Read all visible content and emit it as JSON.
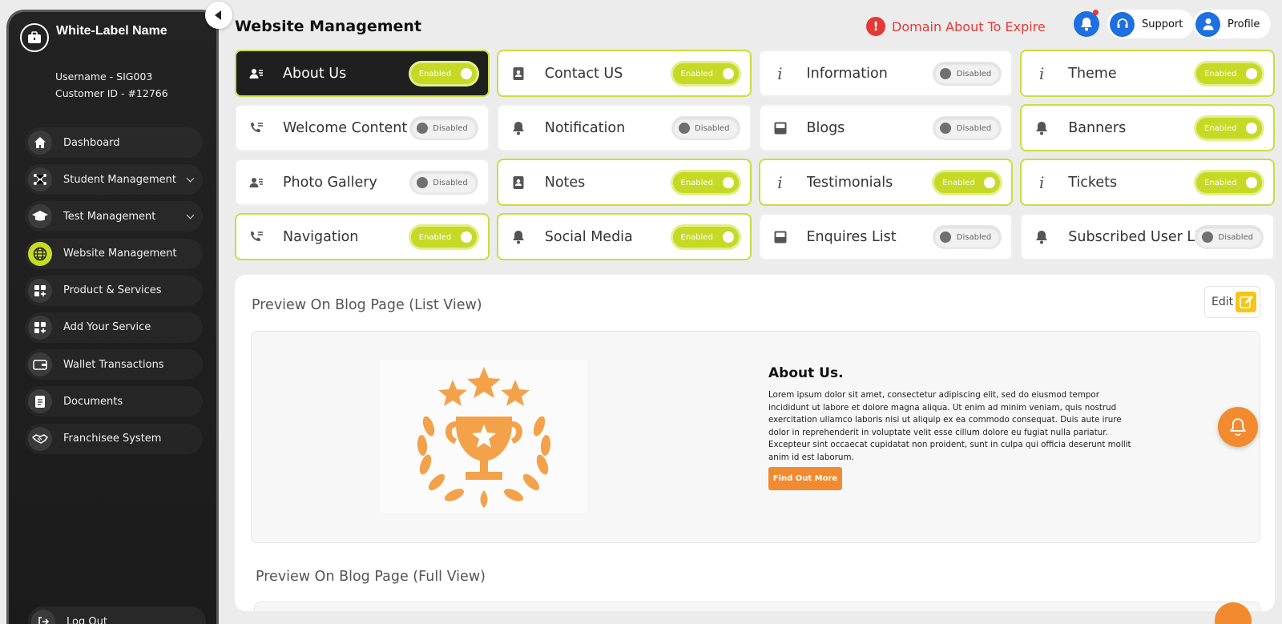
{
  "brand": {
    "name": "White-Label Name"
  },
  "user": {
    "username": "Username - SIG003",
    "customer_id": "Customer ID - #12766"
  },
  "menu": [
    {
      "label": "Dashboard",
      "icon": "home-icon",
      "active": false,
      "expandable": false
    },
    {
      "label": "Student Management",
      "icon": "users-network-icon",
      "active": false,
      "expandable": true
    },
    {
      "label": "Test Management",
      "icon": "graduation-cap-icon",
      "active": false,
      "expandable": true
    },
    {
      "label": "Website Management",
      "icon": "globe-icon",
      "active": true,
      "expandable": false
    },
    {
      "label": "Product & Services",
      "icon": "grid-plus-icon",
      "active": false,
      "expandable": false
    },
    {
      "label": "Add Your Service",
      "icon": "grid-plus-icon",
      "active": false,
      "expandable": false
    },
    {
      "label": "Wallet Transactions",
      "icon": "wallet-icon",
      "active": false,
      "expandable": false
    },
    {
      "label": "Documents",
      "icon": "document-icon",
      "active": false,
      "expandable": false
    },
    {
      "label": "Franchisee System",
      "icon": "handshake-icon",
      "active": false,
      "expandable": false
    }
  ],
  "logout_label": "Log Out",
  "header": {
    "title": "Website Management",
    "domain_alert": "Domain About To Expire",
    "support_label": "Support",
    "profile_label": "Profile"
  },
  "modules": [
    {
      "label": "About Us",
      "icon": "contact-card-icon",
      "status": "Enabled",
      "selected": true
    },
    {
      "label": "Contact US",
      "icon": "address-book-icon",
      "status": "Enabled",
      "selected": false
    },
    {
      "label": "Information",
      "icon": "info-icon",
      "status": "Disabled",
      "selected": false
    },
    {
      "label": "Theme",
      "icon": "info-icon",
      "status": "Enabled",
      "selected": false
    },
    {
      "label": "Welcome Content",
      "icon": "phone-icon",
      "status": "Disabled",
      "selected": false
    },
    {
      "label": "Notification",
      "icon": "bell-icon",
      "status": "Disabled",
      "selected": false
    },
    {
      "label": "Blogs",
      "icon": "tray-icon",
      "status": "Disabled",
      "selected": false
    },
    {
      "label": "Banners",
      "icon": "bell-icon",
      "status": "Enabled",
      "selected": false
    },
    {
      "label": "Photo Gallery",
      "icon": "contact-card-icon",
      "status": "Disabled",
      "selected": false
    },
    {
      "label": "Notes",
      "icon": "address-book-icon",
      "status": "Enabled",
      "selected": false
    },
    {
      "label": "Testimonials",
      "icon": "info-icon",
      "status": "Enabled",
      "selected": false
    },
    {
      "label": "Tickets",
      "icon": "info-icon",
      "status": "Enabled",
      "selected": false
    },
    {
      "label": "Navigation",
      "icon": "phone-icon",
      "status": "Enabled",
      "selected": false
    },
    {
      "label": "Social Media",
      "icon": "bell-icon",
      "status": "Enabled",
      "selected": false
    },
    {
      "label": "Enquires List",
      "icon": "tray-icon",
      "status": "Disabled",
      "selected": false
    },
    {
      "label": "Subscribed User Lis",
      "icon": "bell-icon",
      "status": "Disabled",
      "selected": false
    }
  ],
  "preview": {
    "title": "Preview On Blog Page (List View)",
    "edit_label": "Edit",
    "about_title": "About Us.",
    "about_text": "Lorem ipsum dolor sit amet, consectetur adipiscing elit, sed do eiusmod tempor incididunt ut labore et dolore magna aliqua. Ut enim ad minim veniam, quis nostrud exercitation ullamco laboris nisi ut aliquip ex ea commodo consequat. Duis aute irure dolor in reprehenderit in voluptate velit esse cillum dolore eu fugiat nulla pariatur. Excepteur sint occaecat cupidatat non proident, sunt in culpa qui officia deserunt mollit anim id est laborum.",
    "cta_label": "Find Out More",
    "full_view_title": "Preview On Blog Page (Full View)"
  },
  "colors": {
    "accent": "#c5d925",
    "orange": "#f28a30",
    "blue": "#1e6fe0",
    "alert": "#e53935"
  }
}
